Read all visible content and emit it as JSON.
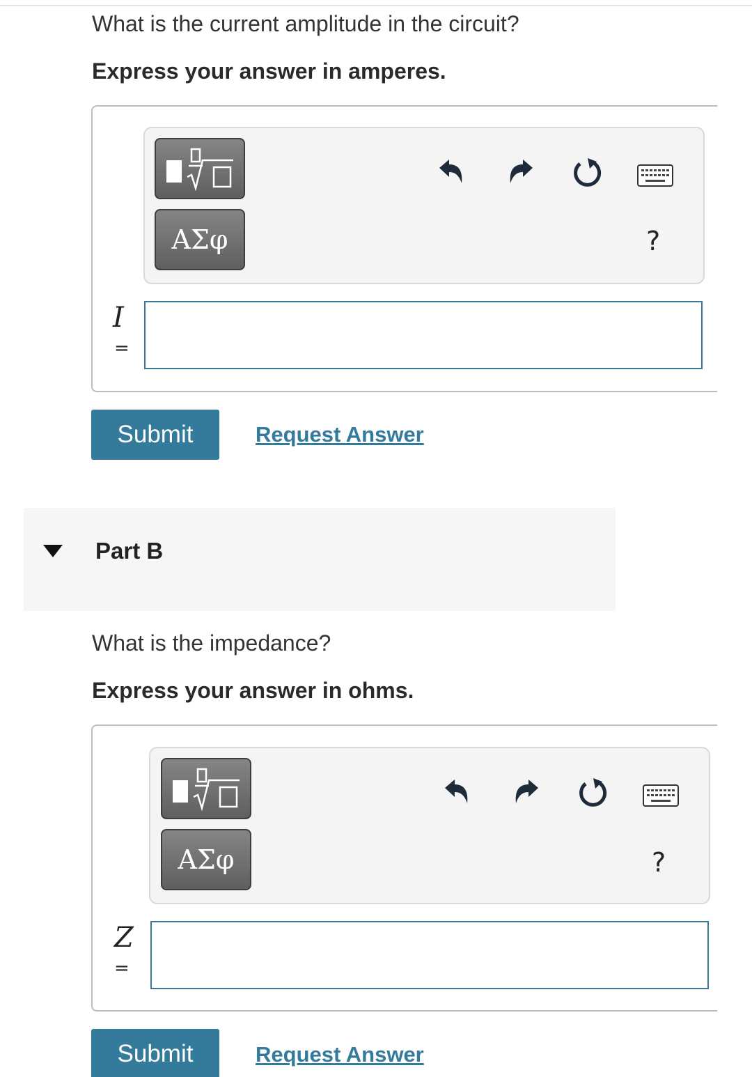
{
  "part_a": {
    "question": "What is the current amplitude in the circuit?",
    "instruction": "Express your answer in amperes.",
    "variable": "I",
    "equals": "=",
    "input_value": "",
    "greek_label": "ΑΣφ",
    "help_label": "?",
    "submit_label": "Submit",
    "request_label": "Request Answer"
  },
  "part_b": {
    "header": "Part B",
    "question": "What is the impedance?",
    "instruction": "Express your answer in ohms.",
    "variable": "Z",
    "equals": "=",
    "input_value": "",
    "greek_label": "ΑΣφ",
    "help_label": "?",
    "submit_label": "Submit",
    "request_label": "Request Answer"
  },
  "icons": {
    "templates": "fraction-sqrt-icon",
    "undo": "undo-icon",
    "redo": "redo-icon",
    "reset": "reset-icon",
    "keyboard": "keyboard-icon",
    "collapse": "caret-down-icon"
  },
  "colors": {
    "accent": "#337a9b",
    "input_border": "#3a7896",
    "tool_button": "#6e6e6e",
    "toolbar_bg": "#f4f4f4",
    "part_header_bg": "#f6f6f6"
  }
}
